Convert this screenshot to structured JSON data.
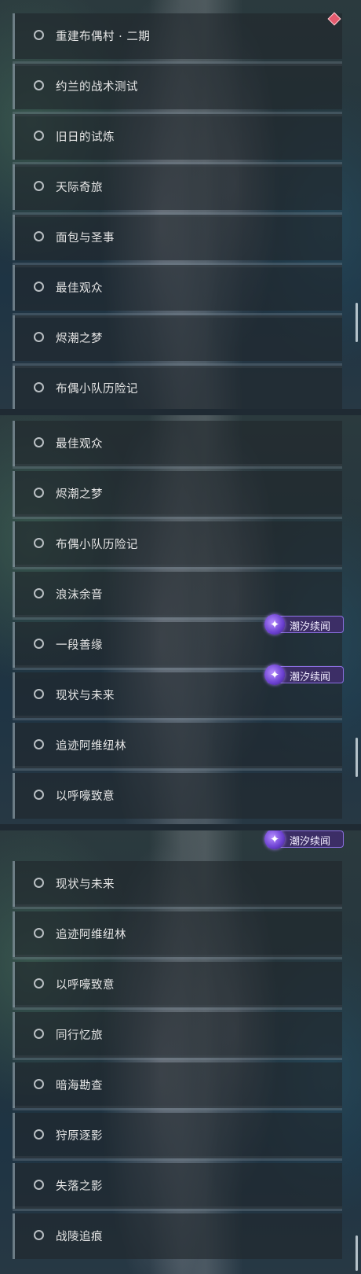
{
  "panels": [
    {
      "items": [
        "重建布偶村 · 二期",
        "约兰的战术测试",
        "旧日的试炼",
        "天际奇旅",
        "面包与圣事",
        "最佳观众",
        "烬潮之梦",
        "布偶小队历险记"
      ]
    },
    {
      "items": [
        "最佳观众",
        "烬潮之梦",
        "布偶小队历险记",
        "浪沫余音",
        "一段善缘",
        "现状与未来",
        "追迹阿维纽林",
        "以呼嚎致意"
      ]
    },
    {
      "items": [
        "现状与未来",
        "追迹阿维纽林",
        "以呼嚎致意",
        "同行忆旅",
        "暗海勘查",
        "狩原逐影",
        "失落之影",
        "战陵追痕"
      ]
    }
  ],
  "badge": {
    "label": "潮汐续闻",
    "icon": "tidal-sequel-icon",
    "color": "#3c2e66",
    "accent": "#8a6fe0"
  },
  "marker": {
    "icon": "red-diamond-icon",
    "color": "#e55a6e"
  }
}
